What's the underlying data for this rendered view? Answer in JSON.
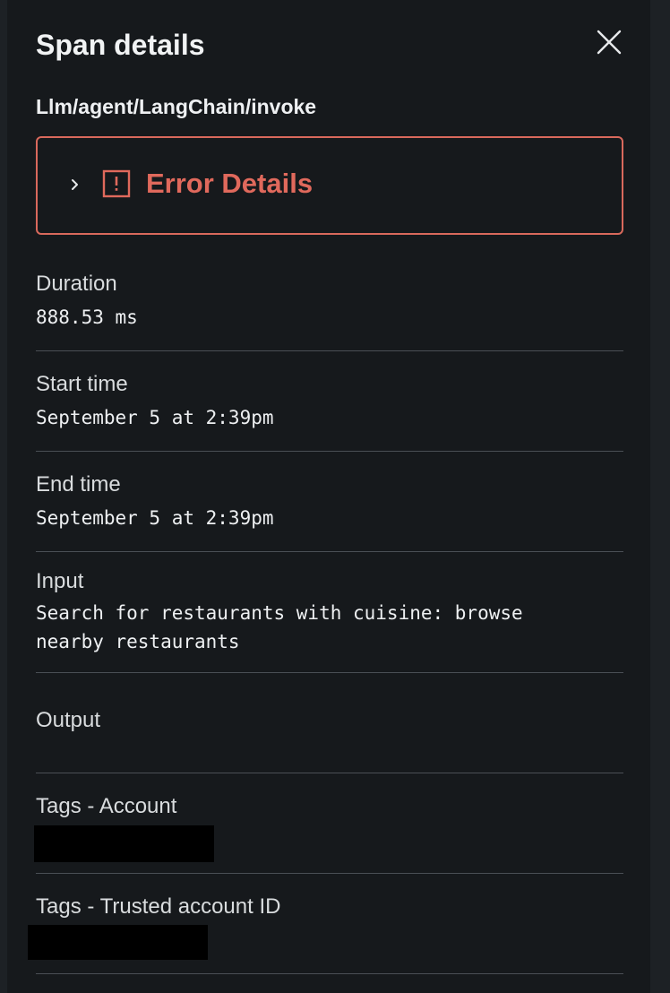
{
  "panel": {
    "title": "Span details",
    "span_name": "Llm/agent/LangChain/invoke"
  },
  "error": {
    "title": "Error Details",
    "icon": "alert-square-icon",
    "color": "#e0695c"
  },
  "fields": {
    "duration": {
      "label": "Duration",
      "value": "888.53 ms"
    },
    "start_time": {
      "label": "Start time",
      "value": "September 5 at 2:39pm"
    },
    "end_time": {
      "label": "End time",
      "value": "September 5 at 2:39pm"
    },
    "input": {
      "label": "Input",
      "value": "Search for restaurants with cuisine: browse\nnearby restaurants"
    },
    "output": {
      "label": "Output",
      "value": ""
    },
    "tags_account": {
      "label": "Tags - Account"
    },
    "tags_trusted_account": {
      "label": "Tags - Trusted account ID"
    }
  }
}
